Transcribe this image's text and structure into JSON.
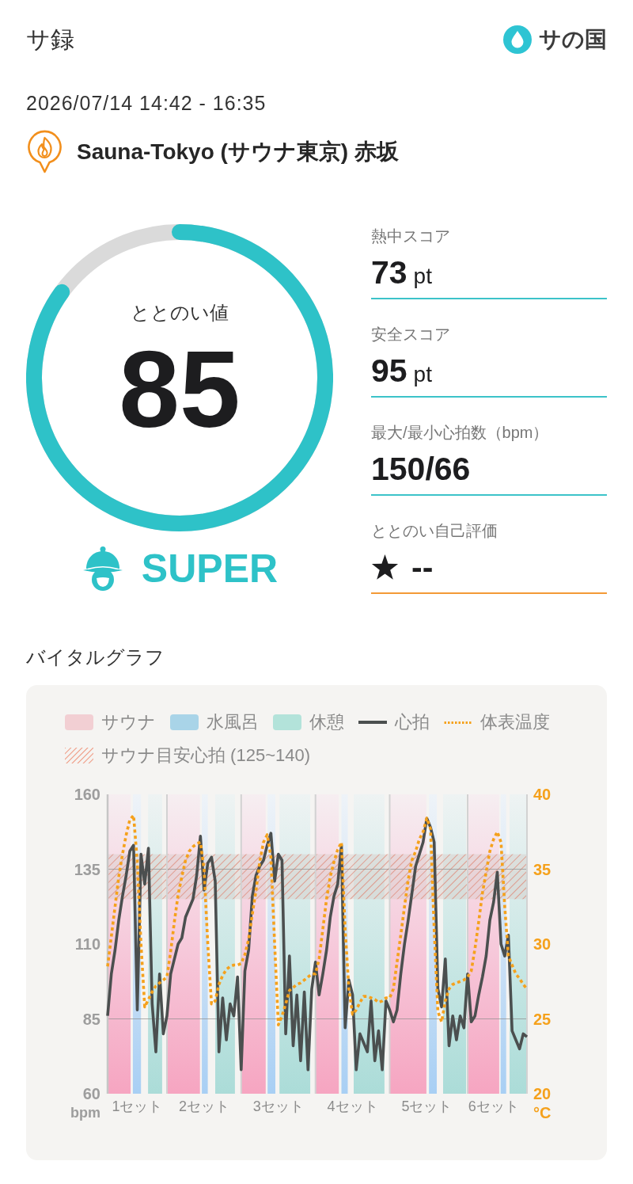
{
  "header": {
    "title": "サ録",
    "logo": "サの国"
  },
  "session": {
    "date_range": "2026/07/14 14:42 - 16:35",
    "facility": "Sauna-Tokyo (サウナ東京) 赤坂"
  },
  "gauge": {
    "label": "ととのい値",
    "value": "85",
    "rank": "SUPER"
  },
  "scores": [
    {
      "kind": "score",
      "label": "熱中スコア",
      "value": "73",
      "unit": "pt"
    },
    {
      "kind": "score",
      "label": "安全スコア",
      "value": "95",
      "unit": "pt"
    },
    {
      "kind": "score",
      "label": "最大/最小心拍数（bpm）",
      "value": "150/66"
    },
    {
      "kind": "rating",
      "label": "ととのい自己評価",
      "value": "--"
    }
  ],
  "vital_graph": {
    "title": "バイタルグラフ",
    "legend": [
      {
        "kind": "fill",
        "label": "サウナ",
        "color": "#f2cfd3"
      },
      {
        "kind": "fill",
        "label": "水風呂",
        "color": "#a9d4e8"
      },
      {
        "kind": "fill",
        "label": "休憩",
        "color": "#b3e3da"
      },
      {
        "kind": "hatch",
        "label": "サウナ目安心拍 (125~140)",
        "color": "#ef9a83"
      }
    ],
    "chart_data": {
      "type": "line",
      "ylabel": "bpm",
      "y2label": "°C",
      "ylim": [
        60,
        160
      ],
      "y2lim": [
        20,
        40
      ],
      "yticks": [
        60,
        85,
        110,
        135,
        160
      ],
      "y2ticks": [
        20,
        25,
        30,
        35,
        40
      ],
      "categories": [
        null,
        null,
        null,
        null,
        null,
        null,
        null,
        null,
        "1セット",
        null,
        null,
        null,
        null,
        null,
        null,
        null,
        null,
        null,
        null,
        null,
        null,
        null,
        null,
        null,
        null,
        null,
        "2セット",
        null,
        null,
        null,
        null,
        null,
        null,
        null,
        null,
        null,
        null,
        null,
        null,
        null,
        null,
        null,
        null,
        null,
        null,
        null,
        "3セット",
        null,
        null,
        null,
        null,
        null,
        null,
        null,
        null,
        null,
        null,
        null,
        null,
        null,
        null,
        null,
        null,
        null,
        null,
        null,
        "4セット",
        null,
        null,
        null,
        null,
        null,
        null,
        null,
        null,
        null,
        null,
        null,
        null,
        null,
        null,
        null,
        null,
        null,
        null,
        null,
        "5セット",
        null,
        null,
        null,
        null,
        null,
        null,
        null,
        null,
        null,
        null,
        null,
        null,
        null,
        null,
        null,
        null,
        null,
        "6セット",
        null,
        null,
        null,
        null,
        null,
        null,
        null,
        null,
        null
      ],
      "series": [
        {
          "name": "心拍",
          "color": "#4b4f4f",
          "axis": "y",
          "values": [
            86,
            100,
            108,
            118,
            126,
            133,
            141,
            143,
            88,
            140,
            130,
            142,
            90,
            74,
            100,
            80,
            86,
            100,
            105,
            110,
            112,
            119,
            122,
            125,
            133,
            146,
            128,
            137,
            139,
            131,
            74,
            92,
            78,
            90,
            86,
            99,
            68,
            101,
            108,
            126,
            133,
            136,
            138,
            143,
            147,
            131,
            140,
            138,
            80,
            106,
            76,
            93,
            71,
            94,
            68,
            95,
            104,
            93,
            100,
            108,
            119,
            126,
            130,
            143,
            82,
            98,
            93,
            68,
            80,
            77,
            74,
            91,
            71,
            81,
            68,
            91,
            88,
            84,
            88,
            100,
            110,
            118,
            127,
            136,
            140,
            144,
            152,
            149,
            144,
            95,
            89,
            105,
            76,
            86,
            78,
            86,
            82,
            100,
            84,
            86,
            93,
            99,
            106,
            118,
            124,
            134,
            110,
            106,
            113,
            81,
            78,
            75,
            80,
            79
          ]
        },
        {
          "name": "体表温度",
          "color": "#f5a11c",
          "axis": "y2",
          "line_style": "dotted",
          "values": [
            28.5,
            30.5,
            32.5,
            34.5,
            36,
            37.3,
            38.3,
            38.6,
            35.5,
            30,
            25.8,
            26.3,
            26.8,
            27.2,
            27.4,
            27.6,
            27.8,
            29.5,
            31.5,
            33.3,
            34.5,
            35.6,
            36.2,
            36.5,
            36.7,
            36.8,
            35,
            30,
            26,
            26.2,
            27.3,
            27.9,
            28.3,
            28.5,
            28.6,
            28.6,
            28.7,
            29.3,
            30.3,
            32,
            33.6,
            35.5,
            36.8,
            37.3,
            35.8,
            30,
            24.6,
            25.2,
            26,
            26.9,
            27.1,
            27.3,
            27.4,
            27.6,
            27.8,
            28,
            28,
            29,
            31,
            33,
            34.5,
            35.5,
            36.3,
            36.8,
            31,
            27,
            25.3,
            25.6,
            26.1,
            26.5,
            26.5,
            26.4,
            26.3,
            26.1,
            26.2,
            26.4,
            26.4,
            27,
            28.8,
            30.6,
            32.5,
            34.3,
            35.6,
            36.2,
            37,
            37.5,
            38.4,
            37.7,
            31,
            25.5,
            24.8,
            26.2,
            27,
            27.3,
            27.4,
            27.5,
            27.6,
            27.8,
            28.2,
            29.7,
            31.5,
            33.4,
            34.8,
            36.2,
            37,
            37.5,
            36.8,
            32.5,
            29.2,
            28.6,
            28,
            27.7,
            27.3,
            27
          ]
        }
      ],
      "bands": [
        {
          "axis": "y",
          "from": 125,
          "to": 140
        }
      ],
      "ref_lines": [
        {
          "axis": "y",
          "value": 85
        },
        {
          "axis": "y",
          "value": 135
        }
      ]
    }
  }
}
